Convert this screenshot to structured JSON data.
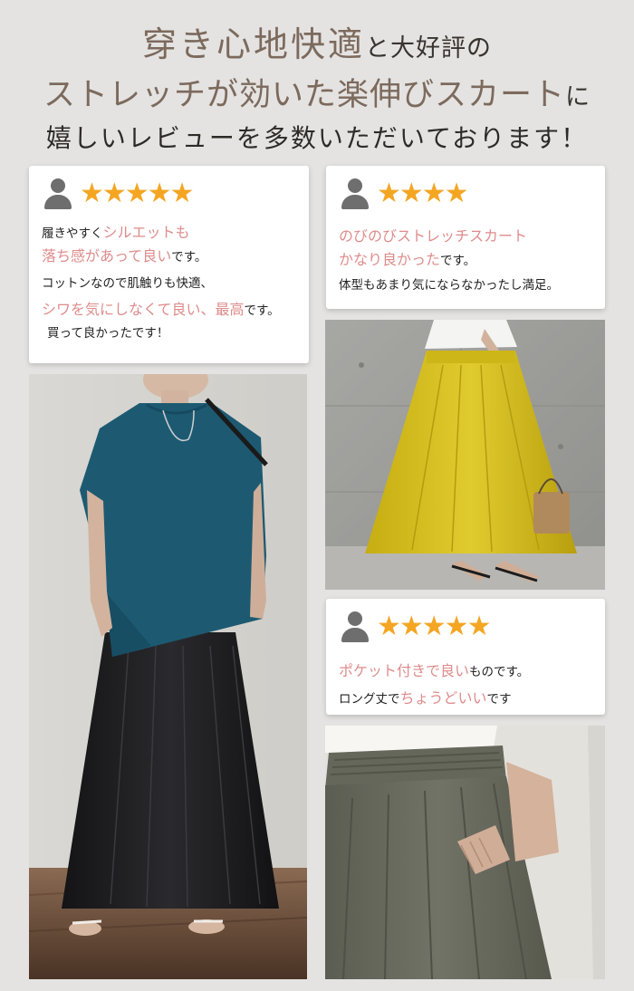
{
  "headline": {
    "line1_big": "穿き心地快適",
    "line1_small": "と大好評の",
    "line2_big": "ストレッチが効いた楽伸びスカート",
    "line2_small": "に",
    "line3": "嬉しいレビューを多数いただいております！"
  },
  "reviews": [
    {
      "stars": "★★★★★",
      "l1a": "履きやすく",
      "l1b": "シルエットも",
      "l2a": "落ち感があって良い",
      "l2b": "です。",
      "l3": "コットンなので肌触りも快適、",
      "l4a": "シワを気にしなくて良い、最高",
      "l4b": "です。",
      "l5": "買って良かったです！"
    },
    {
      "stars": "★★★★",
      "l1": "のびのびストレッチスカート",
      "l2a": "かなり良かった",
      "l2b": "です。",
      "l3": "体型もあまり気にならなかったし満足。"
    },
    {
      "stars": "★★★★★",
      "l1a": "ポケット付きで良い",
      "l1b": "ものです。",
      "l2a": "ロング丈で",
      "l2b": "ちょうどいい",
      "l2c": "です"
    }
  ],
  "colors": {
    "accent_text": "#de8c8c",
    "star": "#f4a623",
    "headline_brown": "#7c6a5d",
    "skirt_black": "#1b1b1d",
    "top_teal": "#1d5a72",
    "skirt_yellow": "#d8c21d",
    "skirt_khaki": "#6b6c60"
  },
  "icons": [
    "user-avatar-icon",
    "star-icon"
  ]
}
